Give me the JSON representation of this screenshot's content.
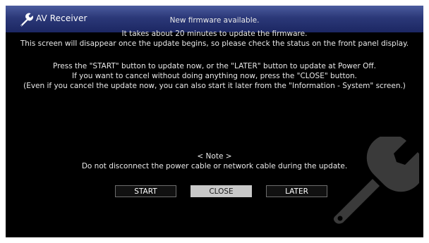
{
  "window": {
    "title": "AV Receiver",
    "icon": "wrench-icon"
  },
  "message": {
    "headline": "New firmware available.",
    "line1": "It takes about 20 minutes to update the firmware.",
    "line2": "This screen will disappear once the update begins, so please check the status on the front panel display.",
    "line3": "Press the \"START\" button to update now, or the \"LATER\" button to update at Power Off.",
    "line4": "If you want to cancel without doing anything now, press the \"CLOSE\" button.",
    "line5": "(Even if you cancel the update now, you can also start it later from the \"Information - System\" screen.)"
  },
  "note": {
    "heading": "< Note >",
    "text": "Do not disconnect the power cable or network cable during the update."
  },
  "buttons": {
    "start": "START",
    "close": "CLOSE",
    "later": "LATER",
    "selected": "close"
  },
  "colors": {
    "titlebar": "#2b3878",
    "background": "#000000",
    "selected_button": "#c8c8c8",
    "text": "#e9e9e9"
  }
}
